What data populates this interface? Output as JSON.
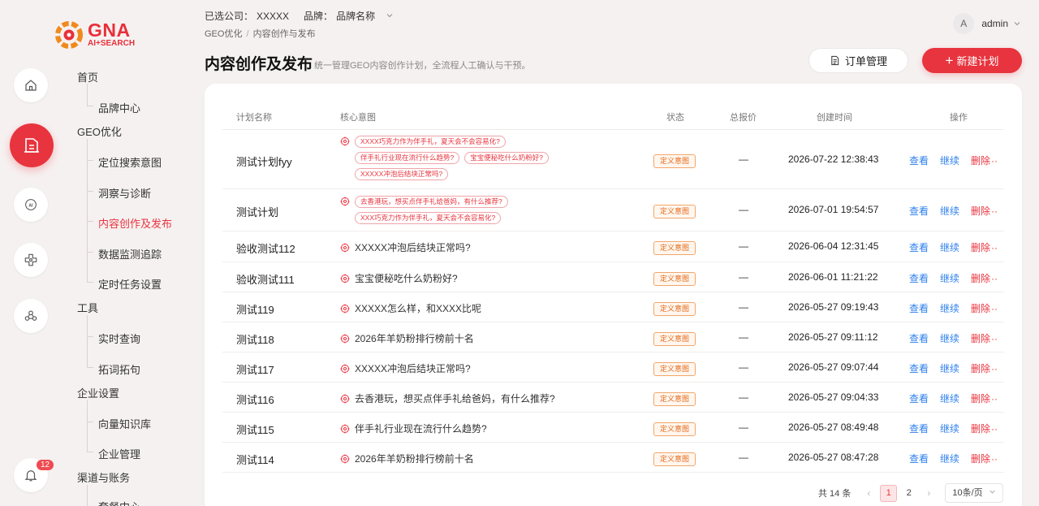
{
  "brand": {
    "name": "GNA",
    "tagline": "AI+SEARCH"
  },
  "header": {
    "company_label": "已选公司：",
    "company_value": "XXXXX",
    "brand_label": "品牌：",
    "brand_value": "品牌名称",
    "breadcrumb": [
      "GEO优化",
      "/",
      "内容创作与发布"
    ],
    "user_initial": "A",
    "user_name": "admin"
  },
  "rail": {
    "icons": [
      "home-icon",
      "document-icon",
      "ai-icon",
      "plugin-icon",
      "team-icon",
      "bell-icon"
    ],
    "notification_count": "12",
    "accent": "#e8343e"
  },
  "nav": {
    "groups": [
      {
        "label": "首页",
        "items": [
          "品牌中心"
        ]
      },
      {
        "label": "GEO优化",
        "items": [
          "定位搜索意图",
          "洞察与诊断",
          "内容创作及发布",
          "数据监测追踪",
          "定时任务设置"
        ]
      },
      {
        "label": "工具",
        "items": [
          "实时查询",
          "拓词拓句"
        ]
      },
      {
        "label": "企业设置",
        "items": [
          "向量知识库",
          "企业管理"
        ]
      },
      {
        "label": "渠道与账务",
        "items": [
          "套餐中心"
        ]
      }
    ],
    "active_item": "内容创作及发布"
  },
  "page": {
    "title": "内容创作及发布",
    "description": "统一管理GEO内容创作计划，全流程人工确认与干预。",
    "order_button": "订单管理",
    "new_button": "新建计划"
  },
  "table": {
    "columns": [
      "计划名称",
      "核心意图",
      "状态",
      "总报价",
      "创建时间",
      "操作"
    ],
    "actions": {
      "view": "查看",
      "continue": "继续",
      "delete": "删除"
    },
    "more_glyph": "··",
    "rows": [
      {
        "name": "测试计划fyy",
        "intents": [
          "XXXX巧克力作为伴手礼，夏天会不会容易化?",
          "伴手礼行业现在流行什么趋势?",
          "宝宝便秘吃什么奶粉好?",
          "XXXXX冲泡后结块正常吗?"
        ],
        "status": "定义意图",
        "price": "—",
        "time": "2026-07-22 12:38:43"
      },
      {
        "name": "测试计划",
        "intents": [
          "去香港玩，想买点伴手礼给爸妈，有什么推荐?",
          "XXX巧克力作为伴手礼，夏天会不会容易化?"
        ],
        "status": "定义意图",
        "price": "—",
        "time": "2026-07-01 19:54:57"
      },
      {
        "name": "验收测试112",
        "intents": [
          "XXXXX冲泡后结块正常吗?"
        ],
        "status": "定义意图",
        "price": "—",
        "time": "2026-06-04 12:31:45"
      },
      {
        "name": "验收测试111",
        "intents": [
          "宝宝便秘吃什么奶粉好?"
        ],
        "status": "定义意图",
        "price": "—",
        "time": "2026-06-01 11:21:22"
      },
      {
        "name": "测试119",
        "intents": [
          "XXXXX怎么样，和XXXX比呢"
        ],
        "status": "定义意图",
        "price": "—",
        "time": "2026-05-27 09:19:43"
      },
      {
        "name": "测试118",
        "intents": [
          "2026年羊奶粉排行榜前十名"
        ],
        "status": "定义意图",
        "price": "—",
        "time": "2026-05-27 09:11:12"
      },
      {
        "name": "测试117",
        "intents": [
          "XXXXX冲泡后结块正常吗?"
        ],
        "status": "定义意图",
        "price": "—",
        "time": "2026-05-27 09:07:44"
      },
      {
        "name": "测试116",
        "intents": [
          "去香港玩，想买点伴手礼给爸妈，有什么推荐?"
        ],
        "status": "定义意图",
        "price": "—",
        "time": "2026-05-27 09:04:33"
      },
      {
        "name": "测试115",
        "intents": [
          "伴手礼行业现在流行什么趋势?"
        ],
        "status": "定义意图",
        "price": "—",
        "time": "2026-05-27 08:49:48"
      },
      {
        "name": "测试114",
        "intents": [
          "2026年羊奶粉排行榜前十名"
        ],
        "status": "定义意图",
        "price": "—",
        "time": "2026-05-27 08:47:28"
      }
    ]
  },
  "pagination": {
    "total_text": "共 14 条",
    "prev": "‹",
    "next": "›",
    "pages": [
      "1",
      "2"
    ],
    "current": "1",
    "page_size": "10条/页"
  },
  "colors": {
    "accent": "#e8343e",
    "link": "#2f80ed",
    "status": "#e46a1a"
  }
}
